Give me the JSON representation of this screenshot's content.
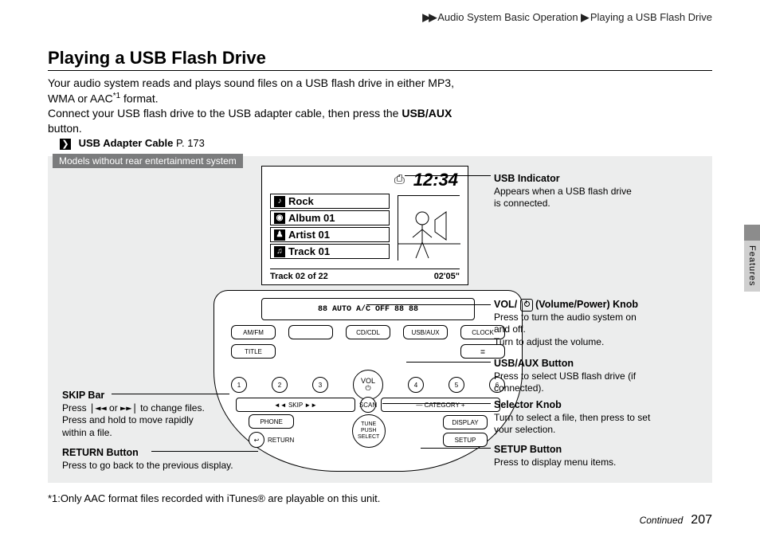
{
  "breadcrumb": {
    "section": "Audio System Basic Operation",
    "page": "Playing a USB Flash Drive"
  },
  "title": "Playing a USB Flash Drive",
  "intro": {
    "line1a": "Your audio system reads and plays sound files on a USB flash drive in either MP3,",
    "line1b": "WMA or AAC",
    "sup": "*1",
    "line1c": " format.",
    "line2a": "Connect your USB flash drive to the USB adapter cable, then press the ",
    "line2bold": "USB/AUX",
    "line2b": " button."
  },
  "xref": {
    "label": "USB Adapter Cable",
    "page": "P. 173"
  },
  "panel": {
    "tag": "Models without rear entertainment system"
  },
  "lcd": {
    "clock": "12:34",
    "rows": {
      "genre": "Rock",
      "album": "Album 01",
      "artist": "Artist 01",
      "track": "Track 01"
    },
    "footer_left": "Track 02 of 22",
    "footer_right": "02'05\""
  },
  "headunit": {
    "display_text": "88 AUTO A/C OFF   88 88",
    "row1": [
      "AM/FM",
      "",
      "CD/CDL",
      "USB/AUX",
      "CLOCK"
    ],
    "row2_left": "TITLE",
    "presets": [
      "1",
      "2",
      "3",
      "4",
      "5",
      "6"
    ],
    "vol_label": "VOL",
    "skip_left": "◄◄  SKIP  ►►",
    "scan": "SCAN",
    "cat": "—   CATEGORY   +",
    "phone": "PHONE",
    "return": "RETURN",
    "display": "DISPLAY",
    "setup": "SETUP",
    "sel": "TUNE PUSH SELECT"
  },
  "callouts": {
    "usb_ind_t": "USB Indicator",
    "usb_ind_b1": "Appears when a USB flash drive",
    "usb_ind_b2": "is connected.",
    "vol_t1": "VOL/ ",
    "vol_t2": " (Volume/Power) Knob",
    "vol_b1": "Press to turn the audio system on",
    "vol_b2": "and off.",
    "vol_b3": "Turn to adjust the volume.",
    "usbaux_t": "USB/AUX Button",
    "usbaux_b1": "Press to select USB flash drive (if",
    "usbaux_b2": "connected).",
    "sel_t": "Selector Knob",
    "sel_b1": "Turn to select a file, then press to set",
    "sel_b2": "your selection.",
    "setup_t": "SETUP Button",
    "setup_b": "Press to display menu items.",
    "skip_t": "SKIP Bar",
    "skip_b1a": "Press ",
    "skip_b1b": " or ",
    "skip_b1c": " to change files.",
    "skip_b2a": "Press and hold to move rapidly",
    "skip_b2b": "within a file.",
    "return_t": "RETURN Button",
    "return_b": "Press to go back to the previous display."
  },
  "footnote": "*1:Only AAC format files recorded with iTunes® are playable on this unit.",
  "pagefoot": {
    "continued": "Continued",
    "num": "207"
  },
  "side_tab": "Features"
}
